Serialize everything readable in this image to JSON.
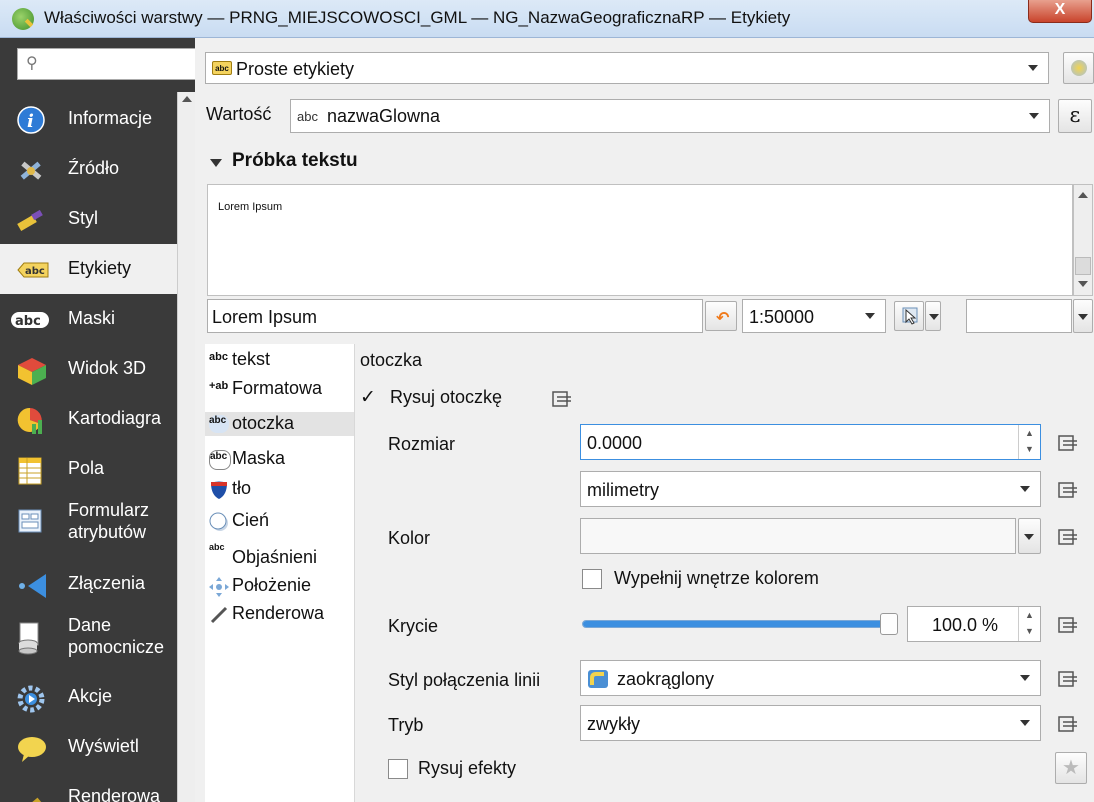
{
  "window": {
    "title": "Właściwości warstwy — PRNG_MIEJSCOWOSCI_GML — NG_NazwaGeograficznaRP — Etykiety",
    "close": "X"
  },
  "sidebar": {
    "items": [
      {
        "label": "Informacje",
        "icon": "info-icon"
      },
      {
        "label": "Źródło",
        "icon": "source-tools-icon"
      },
      {
        "label": "Styl",
        "icon": "paintbrush-icon"
      },
      {
        "label": "Etykiety",
        "icon": "labels-abc-icon"
      },
      {
        "label": "Maski",
        "icon": "mask-abc-icon"
      },
      {
        "label": "Widok 3D",
        "icon": "cube-3d-icon"
      },
      {
        "label": "Kartodiagra",
        "icon": "diagram-icon"
      },
      {
        "label": "Pola",
        "icon": "fields-icon"
      },
      {
        "label": "Formularz atrybutów",
        "icon": "form-icon"
      },
      {
        "label": "Złączenia",
        "icon": "joins-icon"
      },
      {
        "label": "Dane pomocnicze",
        "icon": "auxiliary-db-icon"
      },
      {
        "label": "Akcje",
        "icon": "actions-gear-icon"
      },
      {
        "label": "Wyświetl",
        "icon": "display-tooltip-icon"
      },
      {
        "label": "Renderowa",
        "icon": "rendering-brush-icon"
      }
    ]
  },
  "labels_mode": {
    "value": "Proste etykiety",
    "icon_text": "abc"
  },
  "value_row": {
    "label": "Wartość",
    "type_prefix": "abc",
    "value": "nazwaGlowna",
    "expr_button": "ε"
  },
  "sample": {
    "header": "Próbka tekstu",
    "preview_text": "Lorem Ipsum",
    "input_value": "Lorem Ipsum",
    "scale": "1:50000"
  },
  "tabs": [
    {
      "label": "tekst",
      "icon": "abc"
    },
    {
      "label": "Formatowa",
      "icon": "+ab"
    },
    {
      "label": "otoczka",
      "icon": "abc"
    },
    {
      "label": "Maska",
      "icon": "abc"
    },
    {
      "label": "tło",
      "icon": "background-shield-icon"
    },
    {
      "label": "Cień",
      "icon": "shadow-icon"
    },
    {
      "label": "Objaśnieni",
      "icon": "abc"
    },
    {
      "label": "Położenie",
      "icon": "placement-icon"
    },
    {
      "label": "Renderowa",
      "icon": "rendering-pen-icon"
    }
  ],
  "buffer": {
    "section_title": "otoczka",
    "draw_buffer_label": "Rysuj otoczkę",
    "size_label": "Rozmiar",
    "size_value": "0.0000",
    "unit_value": "milimetry",
    "color_label": "Kolor",
    "fill_label": "Wypełnij wnętrze kolorem",
    "opacity_label": "Krycie",
    "opacity_value": "100.0 %",
    "opacity_fraction": 1.0,
    "join_label": "Styl połączenia linii",
    "join_value": "zaokrąglony",
    "mode_label": "Tryb",
    "mode_value": "zwykły",
    "effects_label": "Rysuj efekty"
  },
  "colors": {
    "sidebar_bg": "#3a3a3a",
    "slider_fill": "#3c8fe0",
    "accent": "#f07a1a"
  }
}
